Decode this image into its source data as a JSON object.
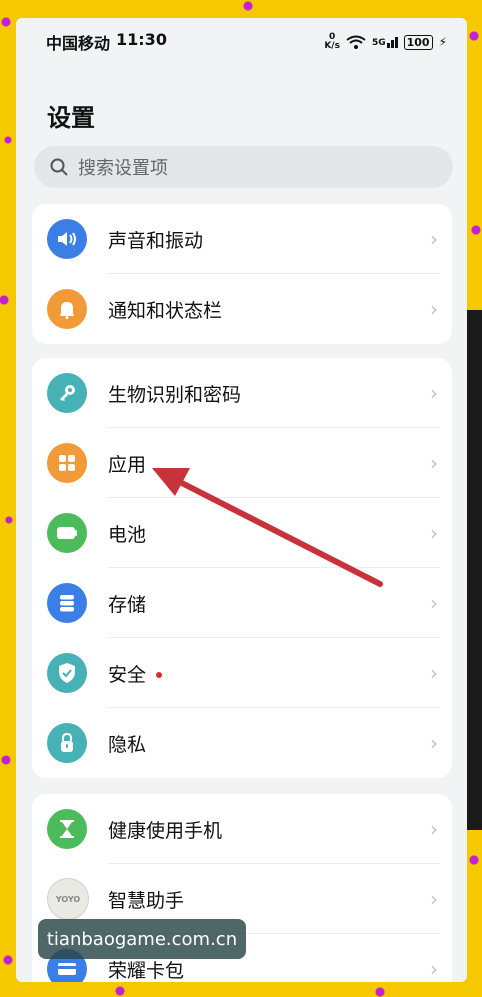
{
  "status_bar": {
    "carrier": "中国移动",
    "time": "11:30",
    "speed_value": "0",
    "speed_unit": "K/s",
    "network": "5G",
    "battery": "100"
  },
  "page_title": "设置",
  "search": {
    "placeholder": "搜索设置项"
  },
  "groups": [
    {
      "items": [
        {
          "label": "声音和振动",
          "icon": "speaker-icon",
          "color": "#3a7ee6"
        },
        {
          "label": "通知和状态栏",
          "icon": "bell-icon",
          "color": "#f29a38"
        }
      ]
    },
    {
      "items": [
        {
          "label": "生物识别和密码",
          "icon": "key-icon",
          "color": "#46b2b6"
        },
        {
          "label": "应用",
          "icon": "apps-grid-icon",
          "color": "#f29a38"
        },
        {
          "label": "电池",
          "icon": "battery-icon",
          "color": "#4cbb5b"
        },
        {
          "label": "存储",
          "icon": "storage-icon",
          "color": "#3a7ee6"
        },
        {
          "label": "安全",
          "icon": "shield-icon",
          "color": "#46b2b6",
          "badge": true
        },
        {
          "label": "隐私",
          "icon": "lock-icon",
          "color": "#46b2b6"
        }
      ]
    },
    {
      "items": [
        {
          "label": "健康使用手机",
          "icon": "hourglass-icon",
          "color": "#4cbb5b"
        },
        {
          "label": "智慧助手",
          "icon": "yoyo-icon",
          "color": "#e9eae3"
        },
        {
          "label": "荣耀卡包",
          "icon": "wallet-icon",
          "color": "#3a7ee6"
        }
      ]
    }
  ],
  "yoyo_text": "YOYO",
  "watermark": "tianbaogame.com.cn",
  "arrow_color": "#c8323a"
}
